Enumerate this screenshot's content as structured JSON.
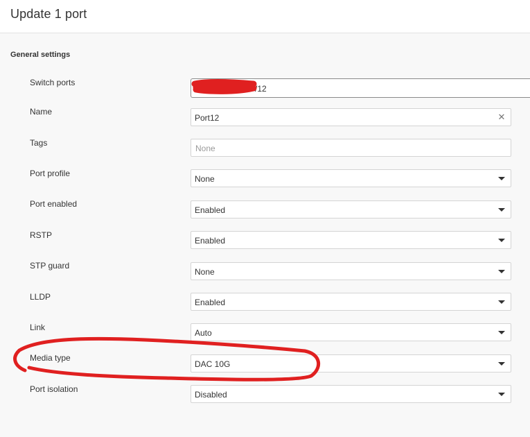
{
  "header": {
    "title": "Update 1 port"
  },
  "section": {
    "title": "General settings"
  },
  "fields": {
    "switch_ports": {
      "label": "Switch ports",
      "value": "/12"
    },
    "name": {
      "label": "Name",
      "value": "Port12"
    },
    "tags": {
      "label": "Tags",
      "placeholder": "None"
    },
    "port_profile": {
      "label": "Port profile",
      "value": "None"
    },
    "port_enabled": {
      "label": "Port enabled",
      "value": "Enabled"
    },
    "rstp": {
      "label": "RSTP",
      "value": "Enabled"
    },
    "stp_guard": {
      "label": "STP guard",
      "value": "None"
    },
    "lldp": {
      "label": "LLDP",
      "value": "Enabled"
    },
    "link": {
      "label": "Link",
      "value": "Auto"
    },
    "media_type": {
      "label": "Media type",
      "value": "DAC 10G"
    },
    "port_isolation": {
      "label": "Port isolation",
      "value": "Disabled"
    }
  },
  "icons": {
    "clear": "close-icon",
    "dropdown": "chevron-down-icon"
  },
  "colors": {
    "annotation": "#e02020",
    "border": "#d4d4d4",
    "text": "#333333",
    "placeholder": "#9a9a9a"
  }
}
